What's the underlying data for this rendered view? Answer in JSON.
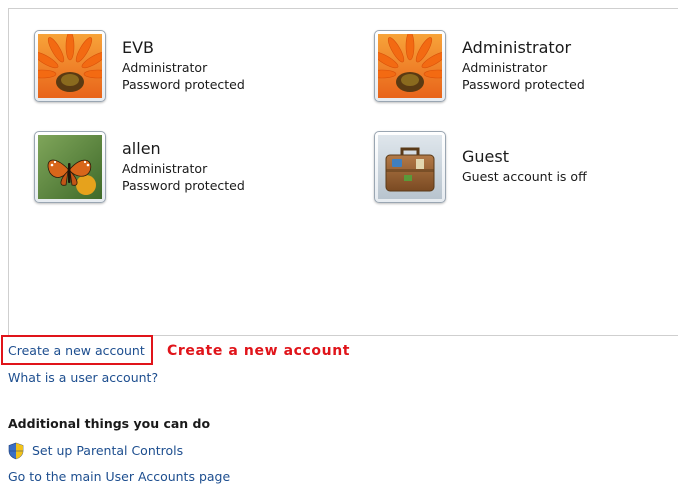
{
  "accounts": [
    {
      "name": "EVB",
      "role": "Administrator",
      "status": "Password protected",
      "picture": "orange-flower-picture"
    },
    {
      "name": "Administrator",
      "role": "Administrator",
      "status": "Password protected",
      "picture": "orange-flower-picture"
    },
    {
      "name": "allen",
      "role": "Administrator",
      "status": "Password protected",
      "picture": "butterfly-picture"
    },
    {
      "name": "Guest",
      "role": "Guest account is off",
      "picture": "suitcase-picture"
    }
  ],
  "links": {
    "create_account": "Create a new account",
    "what_is_account": "What is a user account?"
  },
  "annotation": {
    "text": "Create a new account",
    "color": "#e0141a"
  },
  "additional": {
    "heading": "Additional things you can do",
    "parental_controls": "Set up Parental Controls",
    "parental_controls_icon": "uac-shield-icon",
    "main_page": "Go to the main User Accounts page"
  },
  "colors": {
    "link": "#1d4e8f",
    "highlight": "#e0141a"
  }
}
